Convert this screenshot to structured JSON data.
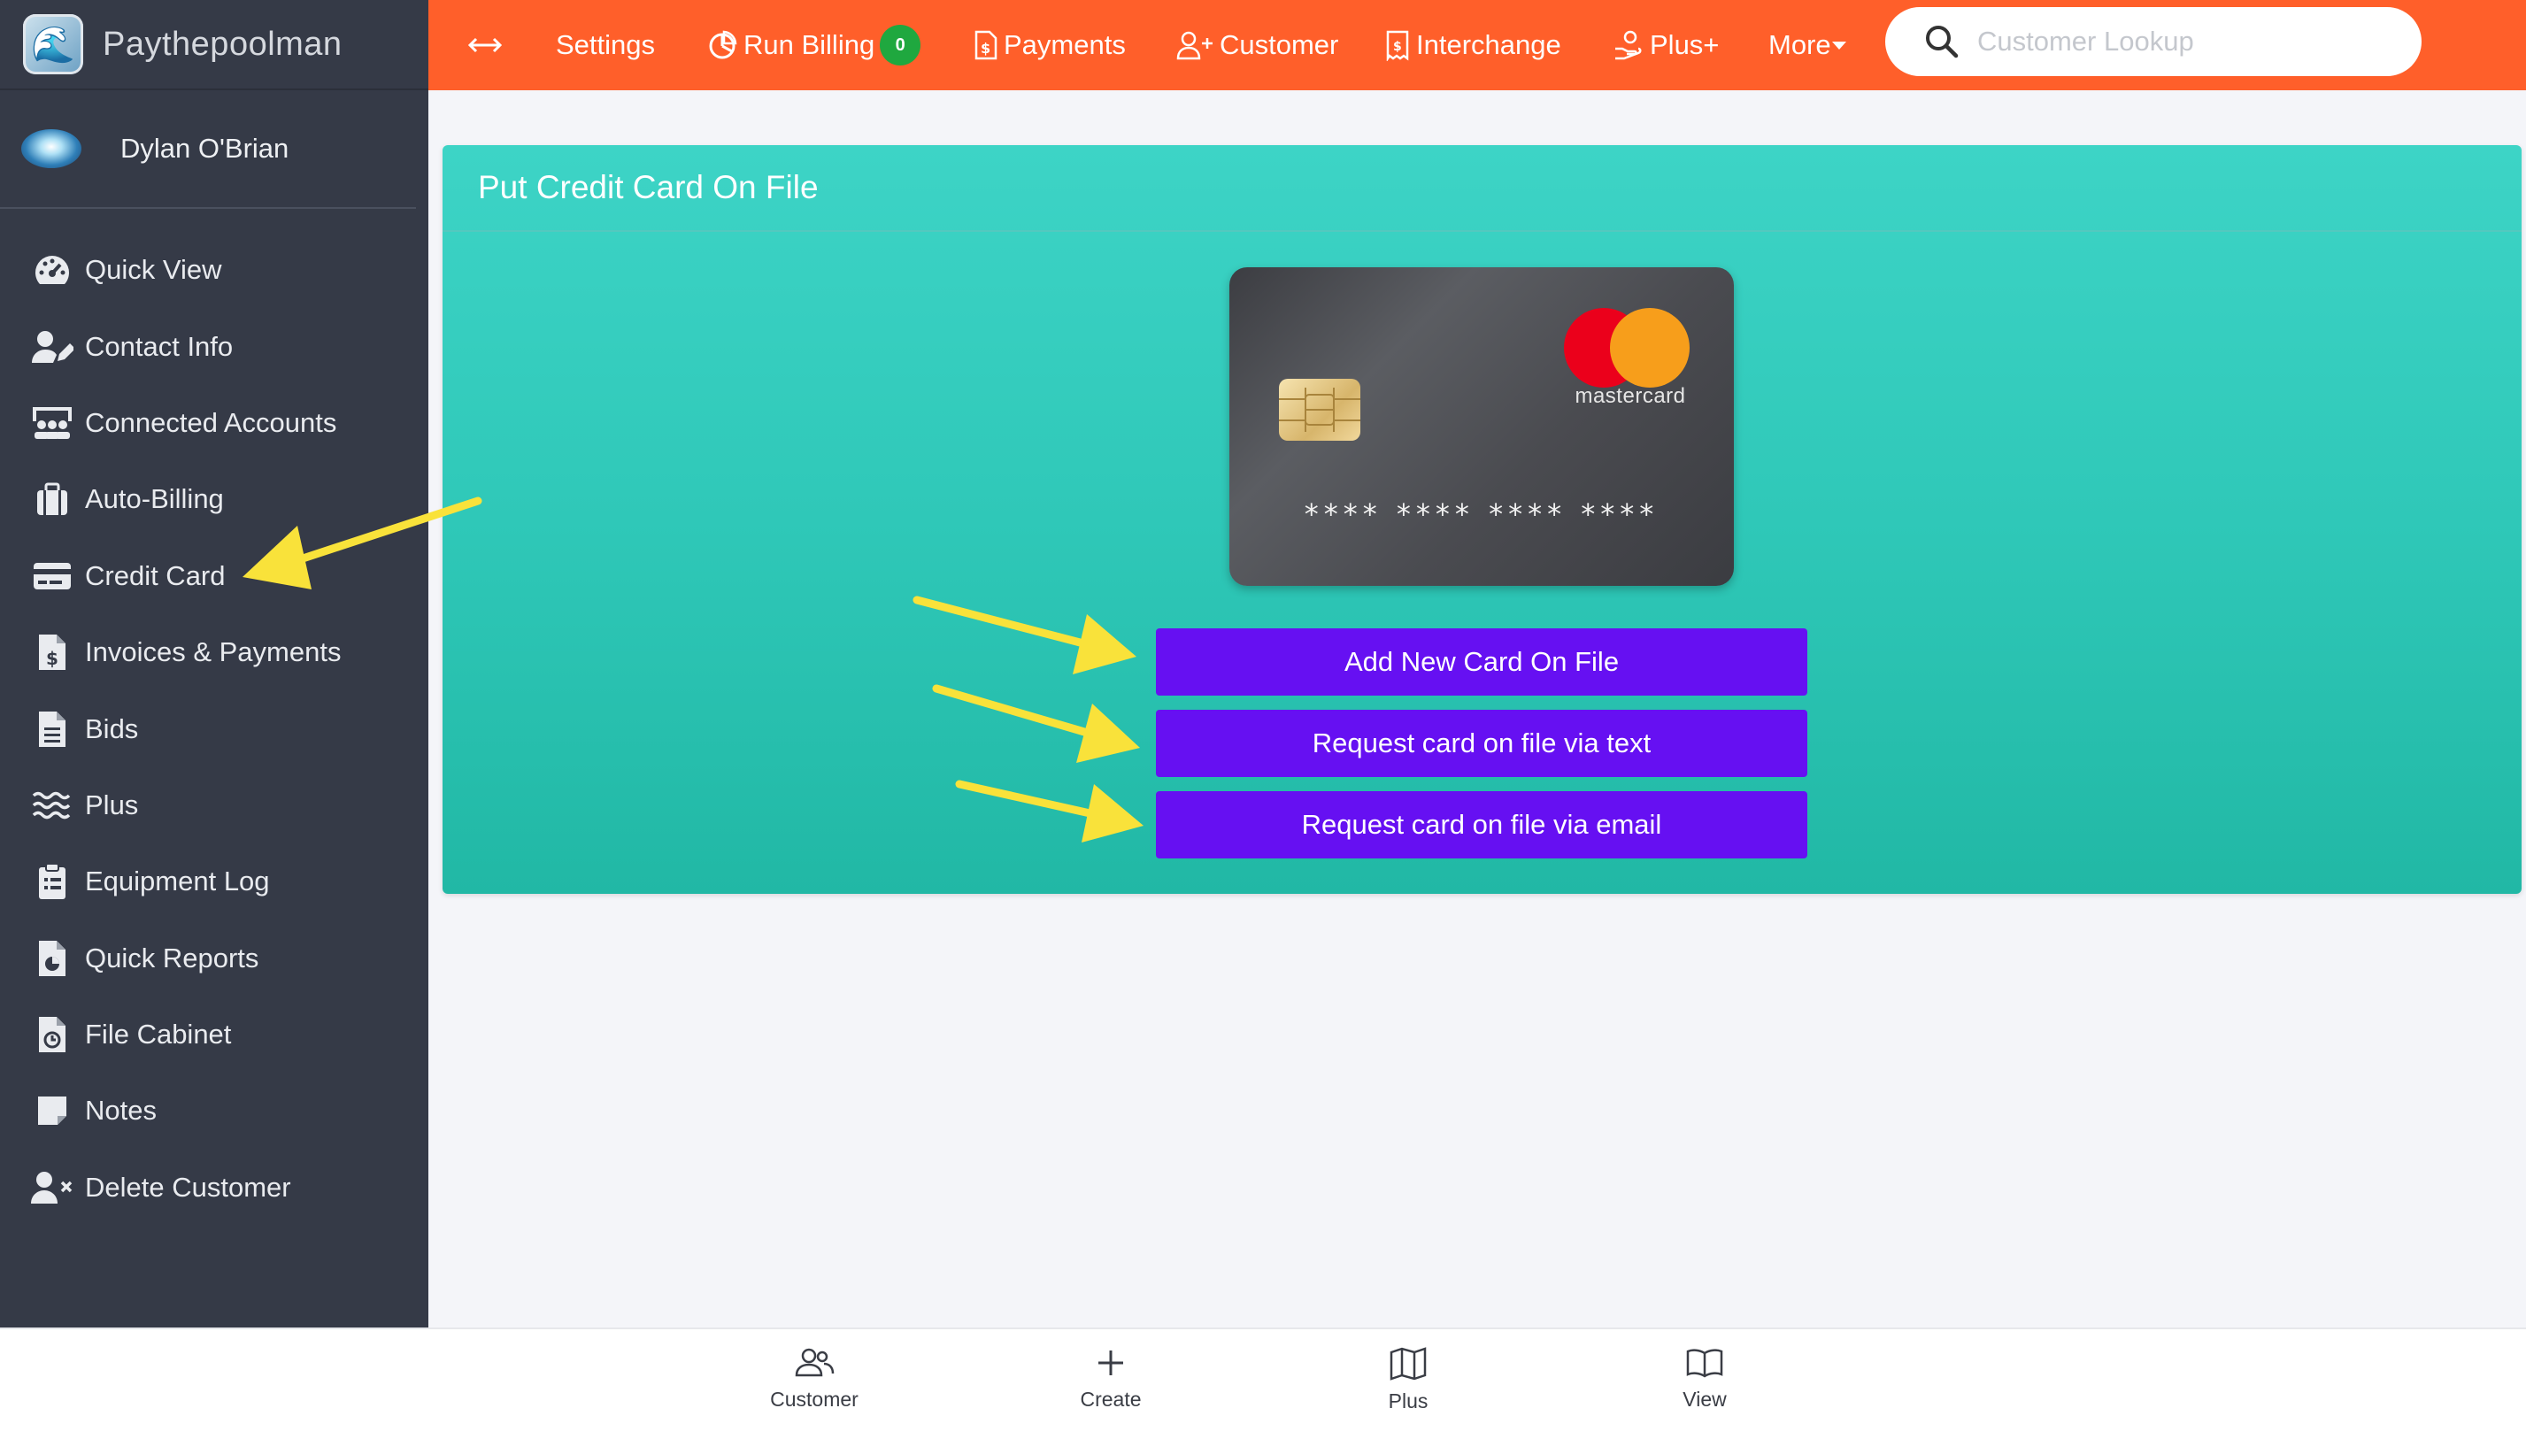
{
  "brand": {
    "name": "Paythepoolman"
  },
  "user": {
    "name": "Dylan O'Brian"
  },
  "sidebar": {
    "items": [
      {
        "label": "Quick View",
        "icon": "gauge-icon"
      },
      {
        "label": "Contact Info",
        "icon": "user-edit-icon"
      },
      {
        "label": "Connected Accounts",
        "icon": "users-icon"
      },
      {
        "label": "Auto-Billing",
        "icon": "briefcase-icon"
      },
      {
        "label": "Credit Card",
        "icon": "credit-card-icon"
      },
      {
        "label": "Invoices & Payments",
        "icon": "invoice-dollar-icon"
      },
      {
        "label": "Bids",
        "icon": "file-lines-icon"
      },
      {
        "label": "Plus",
        "icon": "water-icon"
      },
      {
        "label": "Equipment Log",
        "icon": "clipboard-list-icon"
      },
      {
        "label": "Quick Reports",
        "icon": "file-chart-icon"
      },
      {
        "label": "File Cabinet",
        "icon": "file-clock-icon"
      },
      {
        "label": "Notes",
        "icon": "sticky-note-icon"
      },
      {
        "label": "Delete Customer",
        "icon": "user-x-icon"
      }
    ]
  },
  "topnav": {
    "toggle_icon": "expand-arrows-icon",
    "settings": "Settings",
    "run_billing": "Run Billing",
    "run_billing_count": "0",
    "payments": "Payments",
    "customer": "Customer",
    "interchange": "Interchange",
    "plus": "Plus+",
    "more": "More",
    "search_placeholder": "Customer Lookup"
  },
  "panel": {
    "title": "Put Credit Card On File",
    "card_brand": "mastercard",
    "card_number": "**** **** **** ****",
    "buttons": {
      "add_new": "Add New Card On File",
      "request_text": "Request card on file via text",
      "request_email": "Request card on file via email"
    }
  },
  "bottombar": {
    "customer": "Customer",
    "create": "Create",
    "plus": "Plus",
    "view": "View"
  },
  "colors": {
    "topbar": "#ff5f2a",
    "sidebar": "#353a47",
    "panel": "#2fc8b8",
    "button": "#6610f2",
    "badge": "#1fa83f",
    "annotation_arrow": "#f9e23a"
  }
}
